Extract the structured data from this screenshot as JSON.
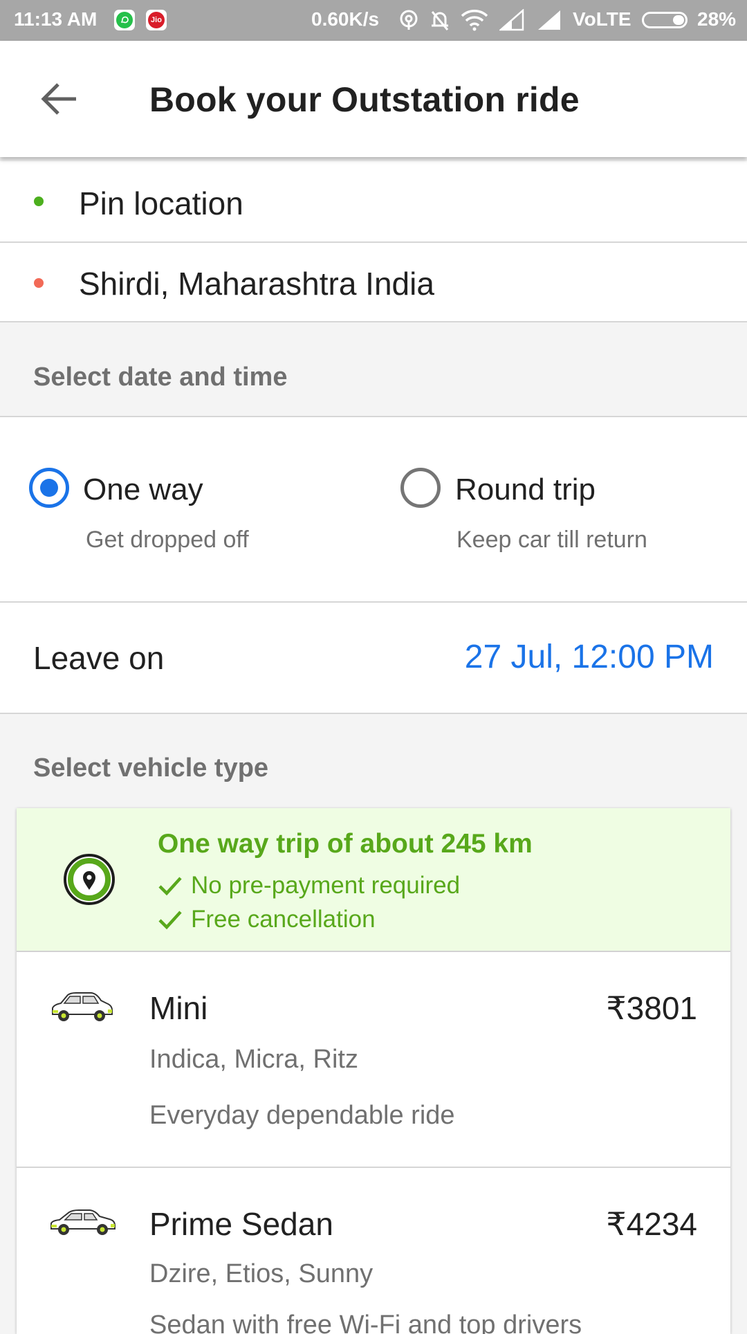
{
  "status_bar": {
    "time": "11:13 AM",
    "speed": "0.60K/s",
    "network": "VoLTE",
    "battery": "28%",
    "icons": [
      "whatsapp-icon",
      "jio-icon",
      "hotspot-icon",
      "bell-muted-icon",
      "wifi-icon",
      "signal-icon",
      "signal-icon",
      "battery-icon"
    ],
    "jio_label": "Jio"
  },
  "header": {
    "title": "Book your Outstation ride"
  },
  "locations": {
    "pickup": "Pin location",
    "drop": "Shirdi, Maharashtra India",
    "pickup_color": "#4caf1e",
    "drop_color": "#f26a57"
  },
  "date_section": {
    "title": "Select date and time"
  },
  "trip_type": {
    "one_way": {
      "label": "One way",
      "sub": "Get dropped off",
      "selected": true
    },
    "round_trip": {
      "label": "Round trip",
      "sub": "Keep car till return",
      "selected": false
    }
  },
  "leave": {
    "label": "Leave on",
    "value": "27 Jul, 12:00 PM"
  },
  "vehicle_section": {
    "title": "Select vehicle type"
  },
  "promo": {
    "headline": "One way trip of about 245 km",
    "perks": [
      "No pre-payment required",
      "Free cancellation"
    ]
  },
  "vehicles": [
    {
      "name": "Mini",
      "price": "₹3801",
      "models": "Indica, Micra, Ritz",
      "desc": "Everyday dependable ride"
    },
    {
      "name": "Prime Sedan",
      "price": "₹4234",
      "models": "Dzire, Etios, Sunny",
      "desc": "Sedan with free Wi-Fi and top drivers"
    }
  ],
  "colors": {
    "accent": "#1a73e8",
    "promo_green": "#58a81b",
    "promo_bg": "#effde3"
  }
}
